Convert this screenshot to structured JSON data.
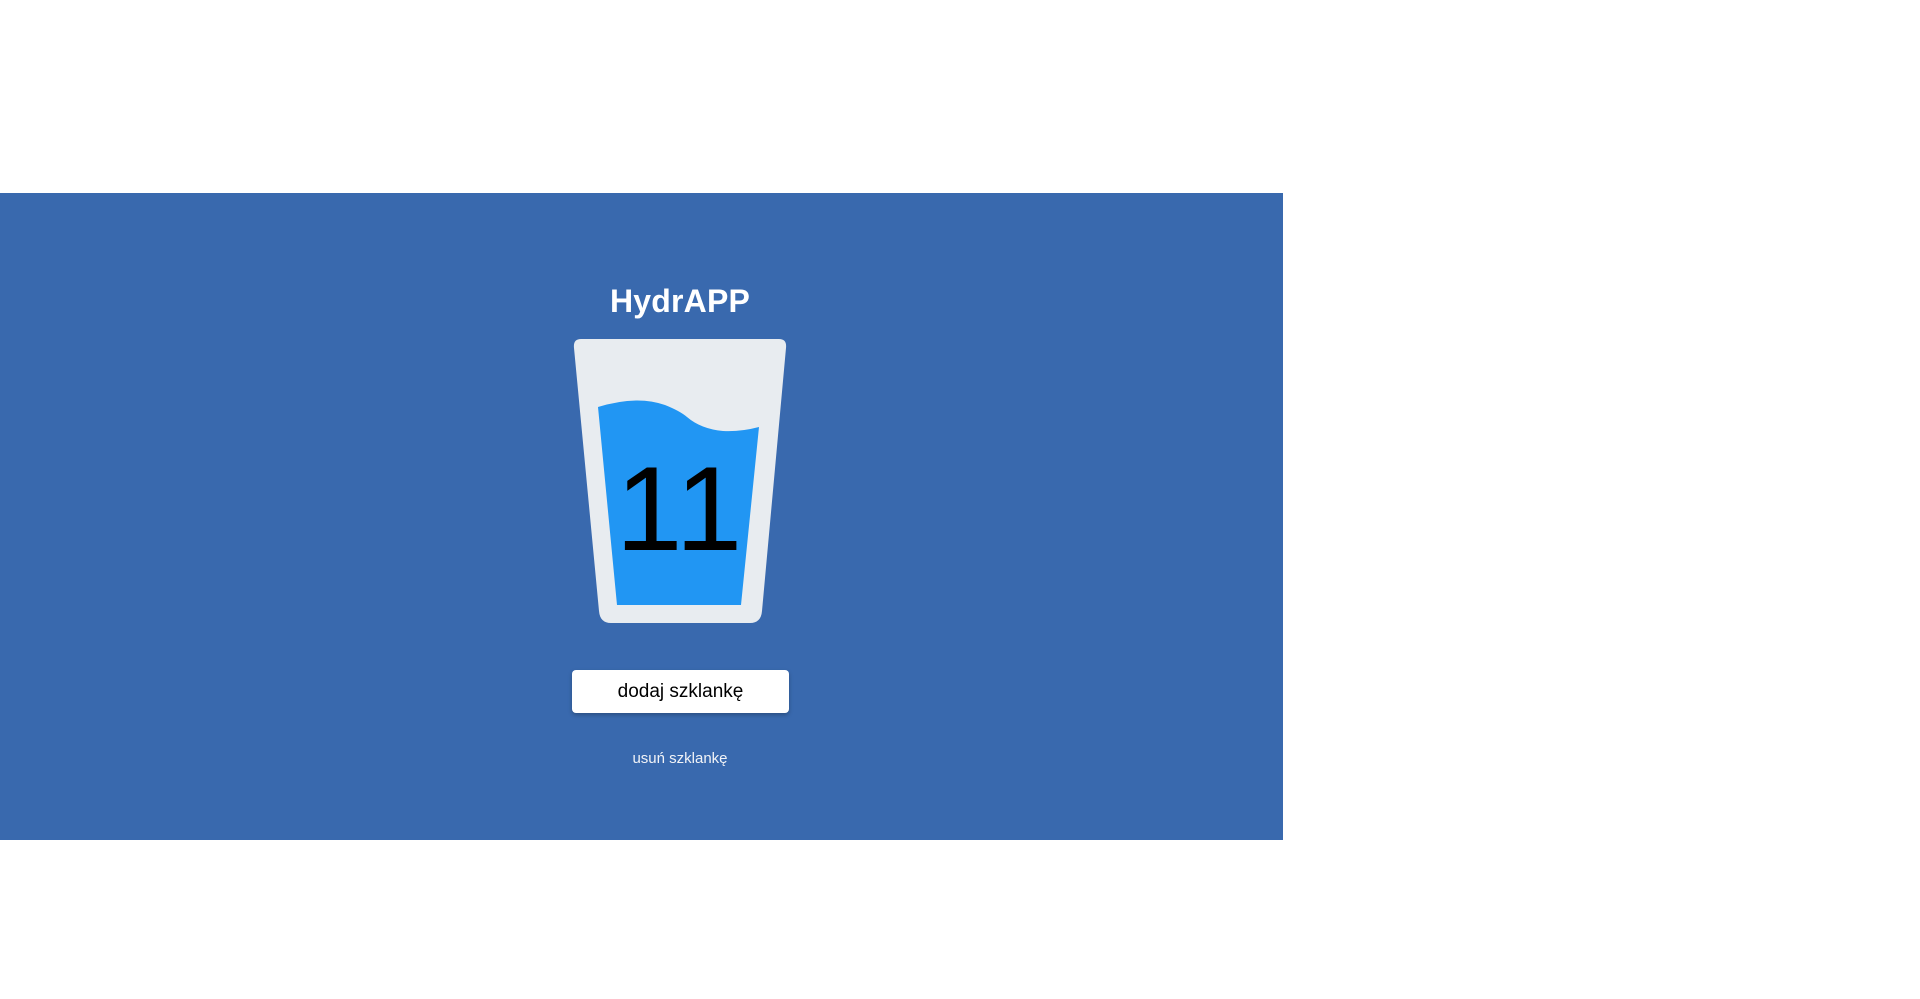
{
  "app": {
    "title": "HydrAPP",
    "glass_count": "11",
    "add_button_label": "dodaj szklankę",
    "remove_link_label": "usuń szklankę"
  },
  "colors": {
    "panel_background": "#3969ae",
    "glass_body": "#e8ecf0",
    "water": "#2196f3",
    "page_background": "#ffffff"
  },
  "icons": {
    "glass": "water-glass-icon"
  }
}
